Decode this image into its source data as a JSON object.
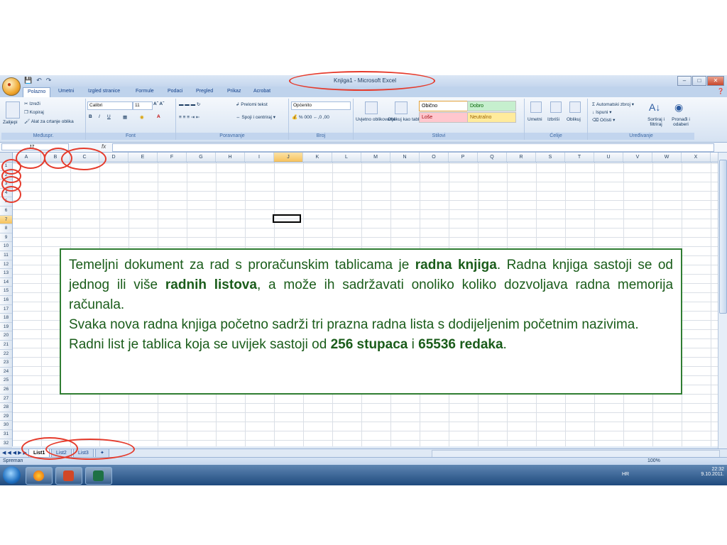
{
  "window": {
    "title": "Knjiga1 - Microsoft Excel"
  },
  "tabs": [
    "Polazno",
    "Umetni",
    "Izgled stranice",
    "Formule",
    "Podaci",
    "Pregled",
    "Prikaz",
    "Acrobat"
  ],
  "ribbon": {
    "clipboard": {
      "paste": "Zalijepi",
      "cut": "Izreži",
      "copy": "Kopiraj",
      "format_painter": "Alat za crtanje oblika",
      "label": "Međuspr."
    },
    "font": {
      "name": "Calibri",
      "size": "11",
      "label": "Font"
    },
    "alignment": {
      "wrap": "Prelomi tekst",
      "merge": "Spoji i centriraj",
      "label": "Poravnanje"
    },
    "number": {
      "format": "Općenito",
      "label": "Broj"
    },
    "styles": {
      "conditional": "Uvjetno oblikovanje",
      "as_table": "Oblikuj kao tablicu",
      "normal": "Obično",
      "good": "Dobro",
      "bad": "Loše",
      "neutral": "Neutralno",
      "label": "Stilovi"
    },
    "cells": {
      "insert": "Umetni",
      "delete": "Izbriši",
      "format": "Oblikuj",
      "label": "Ćelije"
    },
    "editing": {
      "autosum": "Automatski zbroj",
      "fill": "Ispuni",
      "clear": "Očisti",
      "sort": "Sortiraj i filtriraj",
      "find": "Pronađi i odaberi",
      "label": "Uređivanje"
    }
  },
  "formula_bar": {
    "cell_ref": "J7",
    "fx": "fx"
  },
  "columns": [
    "A",
    "B",
    "C",
    "D",
    "E",
    "F",
    "G",
    "H",
    "I",
    "J",
    "K",
    "L",
    "M",
    "N",
    "O",
    "P",
    "Q",
    "R",
    "S",
    "T",
    "U",
    "V",
    "W",
    "X"
  ],
  "rows": [
    "1",
    "2",
    "3",
    "4",
    "5",
    "6",
    "7",
    "8",
    "9",
    "10",
    "11",
    "12",
    "13",
    "14",
    "15",
    "16",
    "17",
    "18",
    "19",
    "20",
    "21",
    "22",
    "23",
    "24",
    "25",
    "26",
    "27",
    "28",
    "29",
    "30",
    "31",
    "32"
  ],
  "sheets": [
    "List1",
    "List2",
    "List3"
  ],
  "status": {
    "text": "Spreman",
    "zoom": "100%"
  },
  "tray": {
    "lang": "HR",
    "time": "22:32",
    "date": "9.10.2011."
  },
  "callout": {
    "p1a": "Temeljni dokument za rad s proračunskim tablicama je ",
    "p1b": "radna knjiga",
    "p1c": ". Radna knjiga sastoji se od jednog ili više ",
    "p1d": "radnih listova",
    "p1e": ", a može ih sadržavati onoliko koliko dozvoljava radna memorija računala.",
    "p2": "Svaka nova radna knjiga početno sadrži tri prazna radna lista s dodijeljenim početnim nazivima.",
    "p3a": "Radni list je tablica koja se uvijek sastoji od ",
    "p3b": "256 stupaca",
    "p3c": " i ",
    "p3d": "65536 redaka",
    "p3e": "."
  }
}
